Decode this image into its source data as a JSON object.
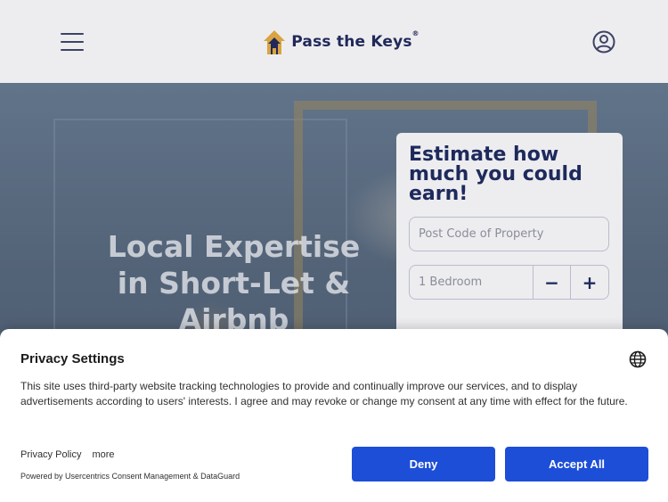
{
  "header": {
    "logo_text": "Pass the Keys",
    "logo_reg": "®"
  },
  "hero": {
    "title": "Local Expertise in Short-Let & Airbnb"
  },
  "estimate": {
    "title": "Estimate how much you could earn!",
    "postcode_placeholder": "Post Code of Property",
    "bedrooms_value": "1 Bedroom",
    "minus_label": "−",
    "plus_label": "+"
  },
  "privacy": {
    "title": "Privacy Settings",
    "text": "This site uses third-party website tracking technologies to provide and continually improve our services, and to display advertisements according to users' interests. I agree and may revoke or change my consent at any time with effect for the future.",
    "policy_link": "Privacy Policy",
    "more_link": "more",
    "powered_by": "Powered by Usercentrics Consent Management & DataGuard",
    "deny_label": "Deny",
    "accept_label": "Accept All"
  },
  "colors": {
    "brand_navy": "#1e2a5c",
    "logo_gold": "#d9a441",
    "button_blue": "#1d4ed8"
  },
  "icons": {
    "menu": "hamburger-icon",
    "logo": "house-logo-icon",
    "account": "user-circle-icon",
    "language": "globe-icon"
  }
}
